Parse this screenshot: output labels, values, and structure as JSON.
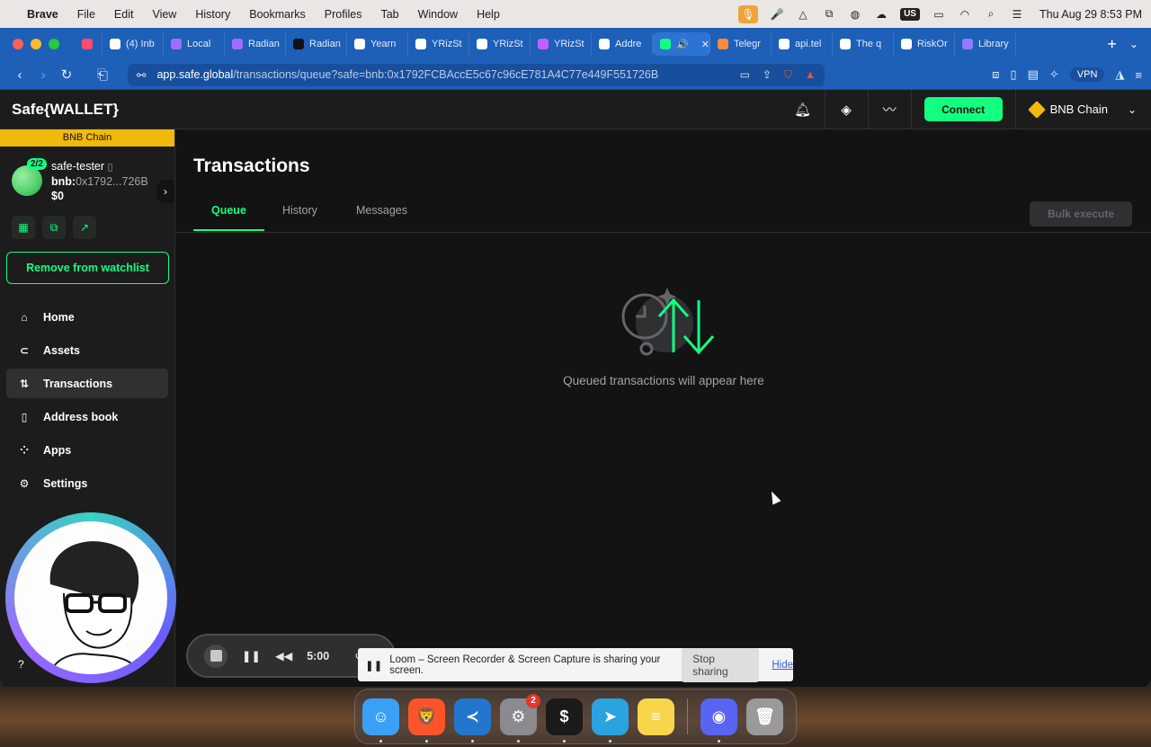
{
  "menubar": {
    "app": "Brave",
    "items": [
      "File",
      "Edit",
      "View",
      "History",
      "Bookmarks",
      "Profiles",
      "Tab",
      "Window",
      "Help"
    ],
    "keyboard": "US",
    "clock": "Thu Aug 29  8:53 PM"
  },
  "tabs": [
    {
      "label": "",
      "icon": "record-icon",
      "color": "#ff4b6e"
    },
    {
      "label": "(4) Inb",
      "icon": "gmail-icon",
      "color": "#ffffff"
    },
    {
      "label": "Local",
      "icon": "triangle-icon",
      "color": "#a06cff"
    },
    {
      "label": "Radian",
      "icon": "triangle-icon",
      "color": "#a06cff"
    },
    {
      "label": "Radian",
      "icon": "sparkle-icon",
      "color": "#111111"
    },
    {
      "label": "Yearn",
      "icon": "chart-icon",
      "color": "#ffffff"
    },
    {
      "label": "YRizSt",
      "icon": "chart-icon",
      "color": "#ffffff"
    },
    {
      "label": "YRizSt",
      "icon": "chart-icon",
      "color": "#ffffff"
    },
    {
      "label": "YRizSt",
      "icon": "vscode-icon",
      "color": "#c060ff"
    },
    {
      "label": "Addre",
      "icon": "globe-icon",
      "color": "#ffffff"
    },
    {
      "label": "",
      "icon": "safe-icon",
      "color": "#12ff80",
      "active": true
    },
    {
      "label": "Telegr",
      "icon": "chart-icon",
      "color": "#ff8a3d"
    },
    {
      "label": "api.tel",
      "icon": "globe-icon",
      "color": "#ffffff"
    },
    {
      "label": "The q",
      "icon": "asterisk-icon",
      "color": "#ffffff"
    },
    {
      "label": "RiskOr",
      "icon": "chart-icon",
      "color": "#ffffff"
    },
    {
      "label": "Library",
      "icon": "gear-icon",
      "color": "#8f7bff"
    }
  ],
  "address": {
    "host": "app.safe.global",
    "path": "/transactions/queue?safe=bnb:0x1792FCBAccE5c67c96cE781A4C77e449F551726B",
    "vpn": "VPN"
  },
  "header": {
    "logo": "Safe{WALLET}",
    "connect": "Connect",
    "chain": "BNB Chain"
  },
  "sidebar": {
    "chain_banner": "BNB Chain",
    "threshold": "2/2",
    "safe_name": "safe-tester",
    "addr_prefix": "bnb:",
    "addr_short": "0x1792...726B",
    "balance": "$0",
    "watchlist_button": "Remove from watchlist",
    "nav": [
      {
        "label": "Home",
        "icon": "home-icon",
        "glyph": "⌂"
      },
      {
        "label": "Assets",
        "icon": "assets-icon",
        "glyph": "⊂"
      },
      {
        "label": "Transactions",
        "icon": "transactions-icon",
        "glyph": "⇅",
        "active": true
      },
      {
        "label": "Address book",
        "icon": "address-book-icon",
        "glyph": "▯"
      },
      {
        "label": "Apps",
        "icon": "apps-icon",
        "glyph": "⁘"
      },
      {
        "label": "Settings",
        "icon": "settings-icon",
        "glyph": "⚙"
      }
    ]
  },
  "main": {
    "title": "Transactions",
    "tabs": [
      "Queue",
      "History",
      "Messages"
    ],
    "bulk_execute": "Bulk execute",
    "empty_text": "Queued transactions will appear here"
  },
  "loom": {
    "timer": "5:00",
    "share_text": "Loom – Screen Recorder & Screen Capture is sharing your screen.",
    "stop_sharing": "Stop sharing",
    "hide": "Hide"
  },
  "dock": {
    "apps": [
      {
        "name": "finder",
        "color": "#3aa0f5",
        "glyph": "☺"
      },
      {
        "name": "brave",
        "color": "#fb542b",
        "glyph": "🦁"
      },
      {
        "name": "vscode",
        "color": "#2277cc",
        "glyph": "≺"
      },
      {
        "name": "system-settings",
        "color": "#8a8a8f",
        "glyph": "⚙",
        "badge": "2"
      },
      {
        "name": "terminal",
        "color": "#1a1a1a",
        "glyph": "$"
      },
      {
        "name": "telegram",
        "color": "#2aa3e0",
        "glyph": "➤"
      },
      {
        "name": "notes",
        "color": "#f7d64c",
        "glyph": "≡"
      },
      {
        "name": "discord",
        "color": "#5865f2",
        "glyph": "◉"
      },
      {
        "name": "trash",
        "color": "#9a9a9a",
        "glyph": "🗑"
      }
    ]
  },
  "colors": {
    "accent": "#12ff80",
    "bnb": "#f0b90b",
    "bg": "#121312",
    "panel": "#1c1c1c"
  }
}
